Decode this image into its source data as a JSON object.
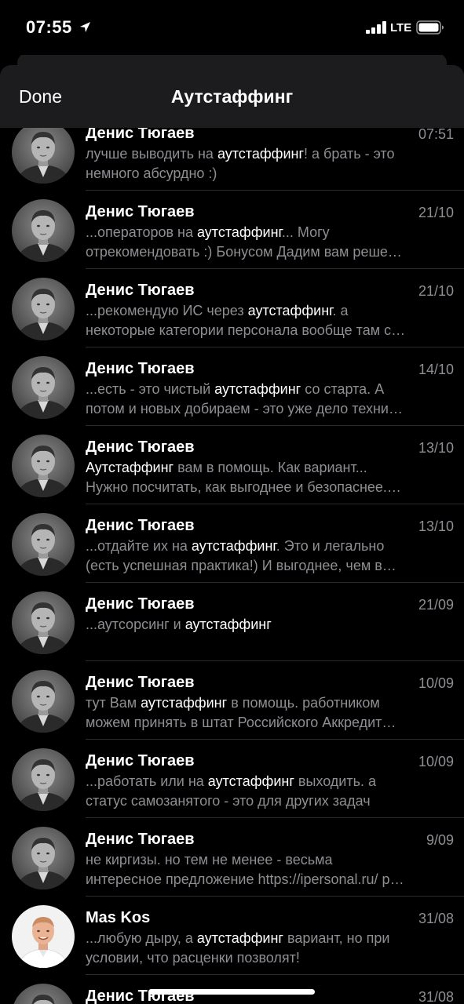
{
  "status_bar": {
    "time": "07:55",
    "network": "LTE"
  },
  "nav": {
    "done_label": "Done",
    "title": "Аутстаффинг"
  },
  "icons": {
    "location": "location-arrow-icon",
    "signal": "cellular-signal-icon",
    "battery": "battery-icon"
  },
  "colors": {
    "background": "#000000",
    "nav_bg": "#1c1c1e",
    "secondary_text": "#8e8e93",
    "highlight_text": "#ffffff"
  },
  "chats": [
    {
      "name": "Денис Тюгаев",
      "date": "07:51",
      "avatar": "denis",
      "line1": [
        {
          "t": "лучше выводить на "
        },
        {
          "t": "аутстаффинг",
          "hl": true
        },
        {
          "t": "! а брать - это"
        }
      ],
      "line2": [
        {
          "t": "немного абсурдно :)"
        }
      ]
    },
    {
      "name": "Денис Тюгаев",
      "date": "21/10",
      "avatar": "denis",
      "line1": [
        {
          "t": "...операторов на "
        },
        {
          "t": "аутстаффинг",
          "hl": true
        },
        {
          "t": "... Могу"
        }
      ],
      "line2": [
        {
          "t": "отрекомендовать :)  Бонусом Дадим вам реше…"
        }
      ]
    },
    {
      "name": "Денис Тюгаев",
      "date": "21/10",
      "avatar": "denis",
      "line1": [
        {
          "t": "...рекомендую ИС через "
        },
        {
          "t": "аутстаффинг",
          "hl": true
        },
        {
          "t": ". а"
        }
      ],
      "line2": [
        {
          "t": "некоторые категории персонала вообще там с…"
        }
      ]
    },
    {
      "name": "Денис Тюгаев",
      "date": "14/10",
      "avatar": "denis",
      "line1": [
        {
          "t": "...есть - это чистый "
        },
        {
          "t": "аутстаффинг",
          "hl": true
        },
        {
          "t": " со старта. А"
        }
      ],
      "line2": [
        {
          "t": "потом и новых добираем - это уже дело техни…"
        }
      ]
    },
    {
      "name": "Денис Тюгаев",
      "date": "13/10",
      "avatar": "denis",
      "line1": [
        {
          "t": "Аутстаффинг",
          "hl": true
        },
        {
          "t": " вам в помощь. Как вариант..."
        }
      ],
      "line2": [
        {
          "t": "Нужно посчитать, как выгоднее и безопаснее.…"
        }
      ]
    },
    {
      "name": "Денис Тюгаев",
      "date": "13/10",
      "avatar": "denis",
      "line1": [
        {
          "t": "...отдайте их на "
        },
        {
          "t": "аутстаффинг",
          "hl": true
        },
        {
          "t": ". Это и легально"
        }
      ],
      "line2": [
        {
          "t": "(есть успешная практика!) И выгоднее, чем в…"
        }
      ]
    },
    {
      "name": "Денис Тюгаев",
      "date": "21/09",
      "avatar": "denis",
      "line1": [
        {
          "t": "...аутсорсинг и "
        },
        {
          "t": "аутстаффинг",
          "hl": true
        }
      ],
      "line2": []
    },
    {
      "name": "Денис Тюгаев",
      "date": "10/09",
      "avatar": "denis",
      "line1": [
        {
          "t": "тут Вам "
        },
        {
          "t": "аутстаффинг",
          "hl": true
        },
        {
          "t": " в помощь. работником"
        }
      ],
      "line2": [
        {
          "t": "можем принять в штат Российского Аккредит…"
        }
      ]
    },
    {
      "name": "Денис Тюгаев",
      "date": "10/09",
      "avatar": "denis",
      "line1": [
        {
          "t": "...работать или на "
        },
        {
          "t": "аутстаффинг",
          "hl": true
        },
        {
          "t": " выходить. а"
        }
      ],
      "line2": [
        {
          "t": "статус самозанятого - это для других задач"
        }
      ]
    },
    {
      "name": "Денис Тюгаев",
      "date": "9/09",
      "avatar": "denis",
      "line1": [
        {
          "t": "не киргизы. но тем не менее - весьма"
        }
      ],
      "line2": [
        {
          "t": "интересное предложение https://ipersonal.ru/ p…"
        }
      ]
    },
    {
      "name": "Mas Kos",
      "date": "31/08",
      "avatar": "mas",
      "line1": [
        {
          "t": "...любую дыру, а "
        },
        {
          "t": "аутстаффинг",
          "hl": true
        },
        {
          "t": " вариант, но при"
        }
      ],
      "line2": [
        {
          "t": "условии, что расценки позволят!"
        }
      ]
    },
    {
      "name": "Денис Тюгаев",
      "date": "31/08",
      "avatar": "denis",
      "line1": [],
      "line2": []
    }
  ]
}
